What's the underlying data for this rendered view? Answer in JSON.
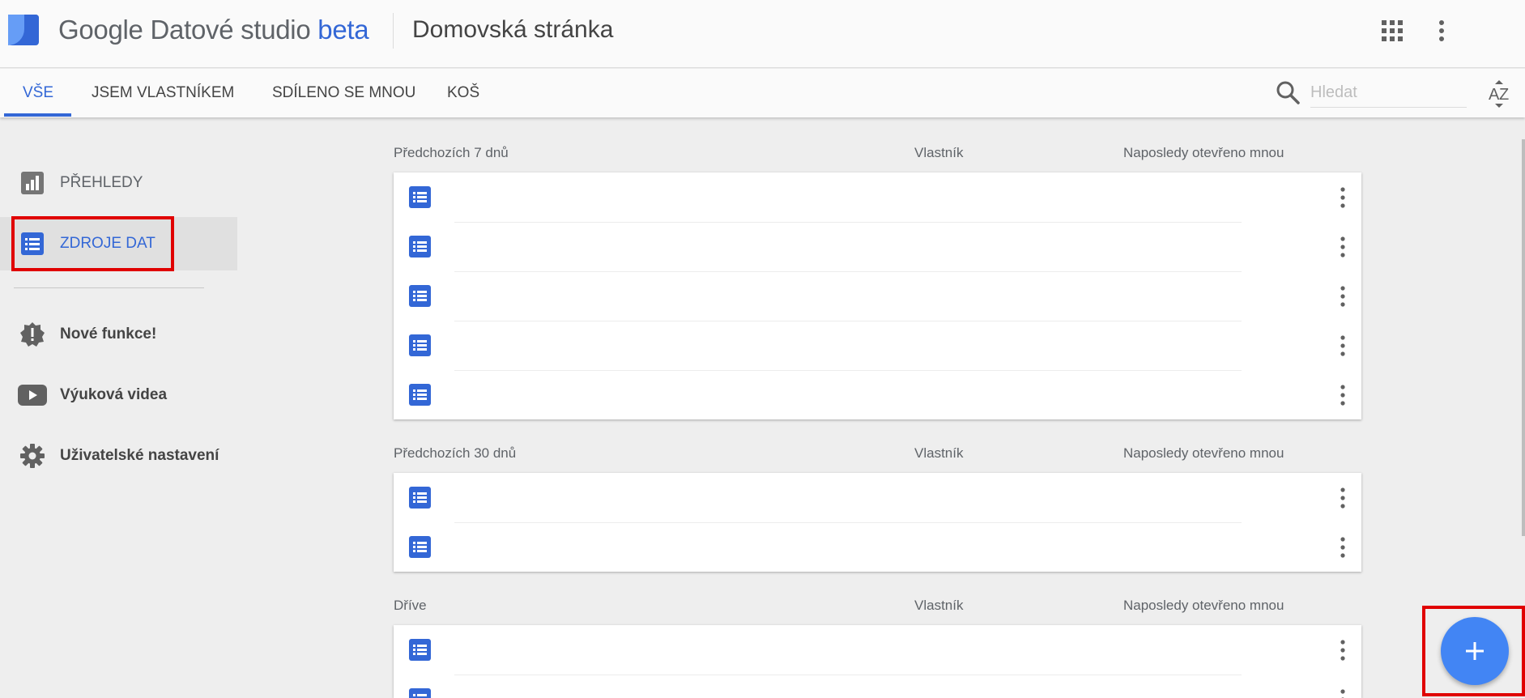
{
  "header": {
    "brand_google": "Google",
    "brand_product": "Datové studio",
    "brand_beta": "beta",
    "page_title": "Domovská stránka"
  },
  "tabs": [
    {
      "label": "VŠE",
      "active": true
    },
    {
      "label": "JSEM VLASTNÍKEM",
      "active": false
    },
    {
      "label": "SDÍLENO SE MNOU",
      "active": false
    },
    {
      "label": "KOŠ",
      "active": false
    }
  ],
  "search": {
    "placeholder": "Hledat"
  },
  "sidebar": {
    "items": [
      {
        "label": "PŘEHLEDY",
        "icon": "bar-chart-icon",
        "active": false
      },
      {
        "label": "ZDROJE DAT",
        "icon": "list-icon",
        "active": true
      }
    ],
    "extras": [
      {
        "label": "Nové funkce!",
        "icon": "alert-badge-icon"
      },
      {
        "label": "Výuková videa",
        "icon": "play-icon"
      },
      {
        "label": "Uživatelské nastavení",
        "icon": "gear-icon"
      }
    ]
  },
  "sections": [
    {
      "title": "Předchozích 7 dnů",
      "owner_col": "Vlastník",
      "opened_col": "Naposledy otevřeno mnou",
      "row_count": 5
    },
    {
      "title": "Předchozích 30 dnů",
      "owner_col": "Vlastník",
      "opened_col": "Naposledy otevřeno mnou",
      "row_count": 2
    },
    {
      "title": "Dříve",
      "owner_col": "Vlastník",
      "opened_col": "Naposledy otevřeno mnou",
      "row_count": 2
    }
  ],
  "fab": {
    "icon": "plus-icon"
  },
  "colors": {
    "accent": "#3367d6",
    "fab": "#4285f4",
    "highlight": "#e00000",
    "background": "#eeeeee"
  }
}
